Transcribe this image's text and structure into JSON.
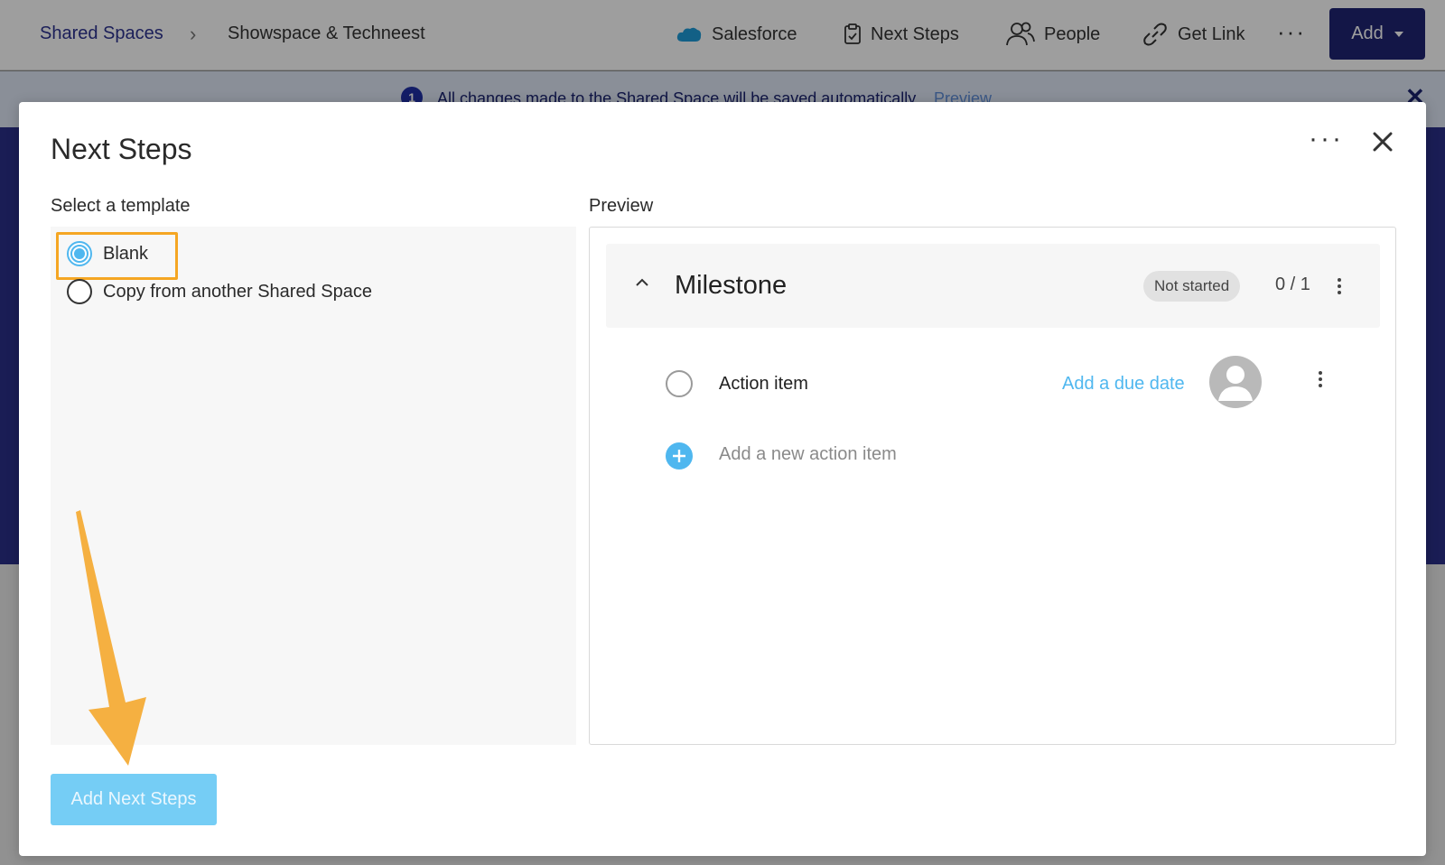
{
  "topbar": {
    "breadcrumb_root": "Shared Spaces",
    "breadcrumb_current": "Showspace & Techneest",
    "nav": {
      "salesforce": "Salesforce",
      "next_steps": "Next Steps",
      "people": "People",
      "get_link": "Get Link"
    },
    "more": "···",
    "add_button": "Add"
  },
  "notice": {
    "icon": "1",
    "text": "All changes made to the Shared Space will be saved automatically.",
    "link": "Preview"
  },
  "modal": {
    "title": "Next Steps",
    "more": "···",
    "select_label": "Select a template",
    "preview_label": "Preview",
    "templates": [
      {
        "label": "Blank",
        "selected": true
      },
      {
        "label": "Copy from another Shared Space",
        "selected": false
      }
    ],
    "preview": {
      "milestone_title": "Milestone",
      "status": "Not started",
      "progress": "0 / 1",
      "action_item": "Action item",
      "due_date_link": "Add a due date",
      "new_action_placeholder": "Add a new action item"
    },
    "primary_button": "Add Next Steps"
  },
  "colors": {
    "accent": "#4fb7ef",
    "brand_navy": "#1f2573",
    "highlight": "#f5a623"
  },
  "icons": {
    "breadcrumb_separator": "chevron-right-icon",
    "salesforce": "salesforce-cloud-icon",
    "next_steps": "clipboard-check-icon",
    "people": "people-icon",
    "get_link": "link-icon",
    "close": "close-icon",
    "collapse": "chevron-up-icon",
    "add": "plus-icon",
    "annotation": "arrow-annotation"
  }
}
